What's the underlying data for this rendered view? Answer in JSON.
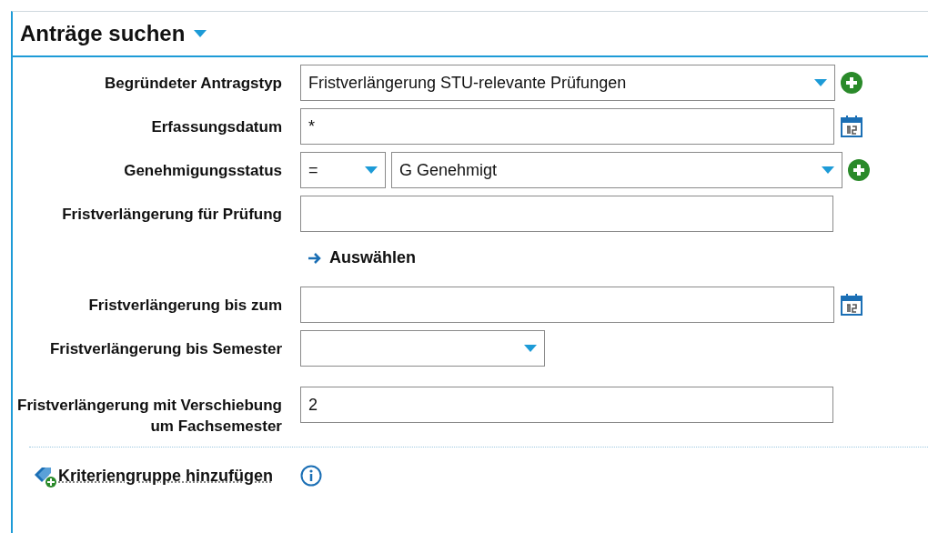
{
  "title": "Anträge suchen",
  "rows": [
    {
      "kind": "select",
      "label": "Begründeter Antragstyp",
      "value": "Fristverlängerung STU-relevante Prüfungen"
    },
    {
      "kind": "date",
      "label": "Erfassungsdatum",
      "value": "*"
    },
    {
      "kind": "compare",
      "label": "Genehmigungsstatus",
      "operator": "=",
      "value": "G Genehmigt"
    },
    {
      "kind": "text",
      "label": "Fristverlängerung für Prüfung",
      "value": ""
    },
    {
      "kind": "action",
      "label": "Auswählen"
    },
    {
      "kind": "date",
      "label": "Fristverlängerung bis zum",
      "value": ""
    },
    {
      "kind": "small-select",
      "label": "Fristverlängerung bis Semester",
      "value": ""
    },
    {
      "kind": "text",
      "label": "Fristverlängerung mit Verschiebung um Fachsemester",
      "value": "2"
    }
  ],
  "footer": {
    "link": "Kriteriengruppe hinzufügen"
  }
}
